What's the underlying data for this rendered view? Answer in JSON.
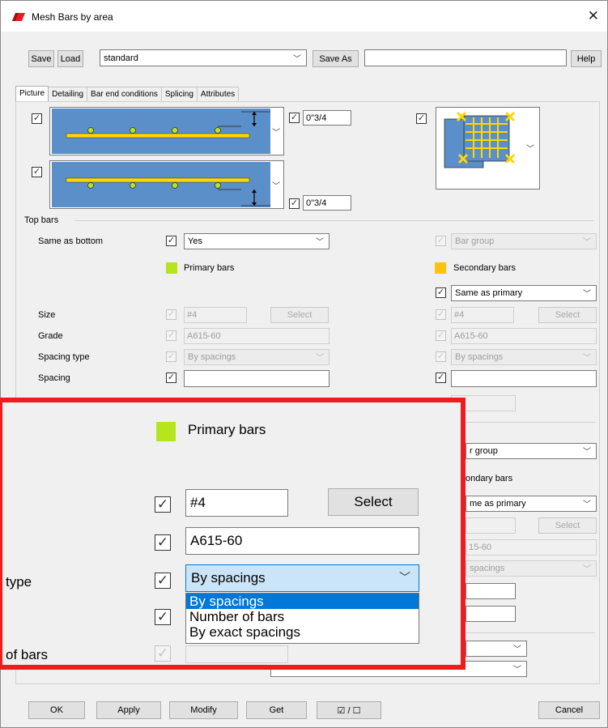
{
  "window": {
    "title": "Mesh Bars by area",
    "close": "✕"
  },
  "toolbar": {
    "save": "Save",
    "load": "Load",
    "preset": "standard",
    "save_as": "Save As",
    "save_as_name": "",
    "help": "Help"
  },
  "tabs": [
    "Picture",
    "Detailing",
    "Bar end conditions",
    "Splicing",
    "Attributes"
  ],
  "picture": {
    "top_cover": "0\"3/4",
    "bottom_cover": "0\"3/4"
  },
  "top_bars": {
    "group_label": "Top bars",
    "same_as_bottom_label": "Same as bottom",
    "same_as_bottom_value": "Yes",
    "bar_group": "Bar group",
    "primary_label": "Primary bars",
    "secondary_label": "Secondary bars",
    "same_as_primary": "Same as primary",
    "size_label": "Size",
    "size_value": "#4",
    "grade_label": "Grade",
    "grade_value": "A615-60",
    "spacing_type_label": "Spacing type",
    "spacing_type_value": "By spacings",
    "spacing_label": "Spacing",
    "spacing_value": "",
    "select": "Select"
  },
  "background_right": {
    "bar_group": "r group",
    "secondary": "ondary bars",
    "same_as_primary": "me as primary",
    "select": "Select",
    "grade": "15-60",
    "spacing_type": "spacings"
  },
  "zoom": {
    "primary_label": "Primary bars",
    "size_value": "#4",
    "select": "Select",
    "grade_value": "A615-60",
    "type_label": "type",
    "spacing_type_value": "By spacings",
    "of_bars_label": "of bars",
    "options": [
      "By spacings",
      "Number of bars",
      "By exact spacings"
    ]
  },
  "bottom_bar": {
    "ok": "OK",
    "apply": "Apply",
    "modify": "Modify",
    "get": "Get",
    "toggle": "☑ / ☐",
    "cancel": "Cancel"
  },
  "colors": {
    "primary": "#b5e61d",
    "secondary": "#ffc20e",
    "picture_bg": "#5b8fc9",
    "bar": "#ffd800",
    "zoom_border": "#ee1c1c",
    "selection": "#0078d7"
  }
}
